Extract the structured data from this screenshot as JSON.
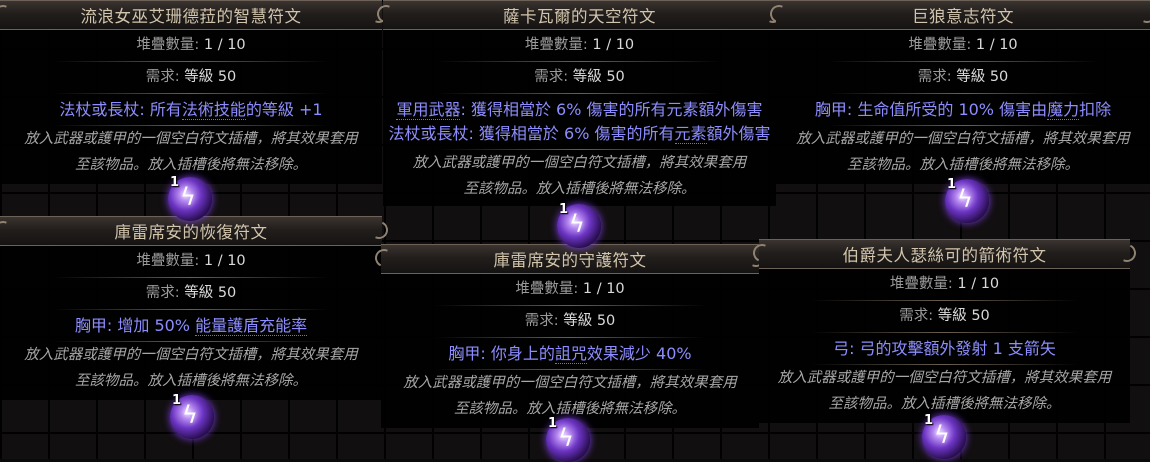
{
  "tooltips": [
    {
      "title": "流浪女巫艾珊德菈的智慧符文",
      "stack": {
        "label": "堆疊數量:",
        "value": "1 / 10"
      },
      "req": {
        "label": "需求:",
        "value": "等級 50"
      },
      "mods": [
        {
          "prefix": "法杖或長杖: 所有",
          "link": "法術技能",
          "suffix": "的等級 +1"
        }
      ],
      "desc1": "放入武器或護甲的一個空白符文插槽，將其效果套用",
      "desc2": "至該物品。放入插槽後將無法移除。",
      "count": "1"
    },
    {
      "title": "薩卡瓦爾的天空符文",
      "stack": {
        "label": "堆疊數量:",
        "value": "1 / 10"
      },
      "req": {
        "label": "需求:",
        "value": "等級 50"
      },
      "mods": [
        {
          "prefix": "",
          "link": "軍用武器",
          "suffix": ": 獲得相當於 6% 傷害的所有元素額外傷害"
        },
        {
          "prefix": "法杖或長杖: 獲得相當於 6% 傷害的所有",
          "link": "元素",
          "suffix": "額外傷害"
        }
      ],
      "desc1": "放入武器或護甲的一個空白符文插槽，將其效果套用",
      "desc2": "至該物品。放入插槽後將無法移除。",
      "count": "1"
    },
    {
      "title": "巨狼意志符文",
      "stack": {
        "label": "堆疊數量:",
        "value": "1 / 10"
      },
      "req": {
        "label": "需求:",
        "value": "等級 50"
      },
      "mods": [
        {
          "prefix": "胸甲: 生命值所受的 10% 傷害由",
          "link": "魔力",
          "suffix": "扣除"
        }
      ],
      "desc1": "放入武器或護甲的一個空白符文插槽，將其效果套用",
      "desc2": "至該物品。放入插槽後將無法移除。",
      "count": "1"
    },
    {
      "title": "庫雷席安的恢復符文",
      "stack": {
        "label": "堆疊數量:",
        "value": "1 / 10"
      },
      "req": {
        "label": "需求:",
        "value": "等級 50"
      },
      "mods": [
        {
          "prefix": "胸甲: 增加 50% ",
          "link": "能量護盾充能率",
          "suffix": ""
        }
      ],
      "desc1": "放入武器或護甲的一個空白符文插槽，將其效果套用",
      "desc2": "至該物品。放入插槽後將無法移除。",
      "count": "1"
    },
    {
      "title": "庫雷席安的守護符文",
      "stack": {
        "label": "堆疊數量:",
        "value": "1 / 10"
      },
      "req": {
        "label": "需求:",
        "value": "等級 50"
      },
      "mods": [
        {
          "prefix": "胸甲: 你身上的",
          "link": "詛咒",
          "suffix": "效果減少 40%"
        }
      ],
      "desc1": "放入武器或護甲的一個空白符文插槽，將其效果套用",
      "desc2": "至該物品。放入插槽後將無法移除。",
      "count": "1"
    },
    {
      "title": "伯爵夫人瑟絲可的箭術符文",
      "stack": {
        "label": "堆疊數量:",
        "value": "1 / 10"
      },
      "req": {
        "label": "需求:",
        "value": "等級 50"
      },
      "mods": [
        {
          "prefix": "弓: 弓的攻擊額外發射 1 支箭矢",
          "link": "",
          "suffix": ""
        }
      ],
      "desc1": "放入武器或護甲的一個空白符文插槽，將其效果套用",
      "desc2": "至該物品。放入插槽後將無法移除。",
      "count": "1"
    }
  ]
}
